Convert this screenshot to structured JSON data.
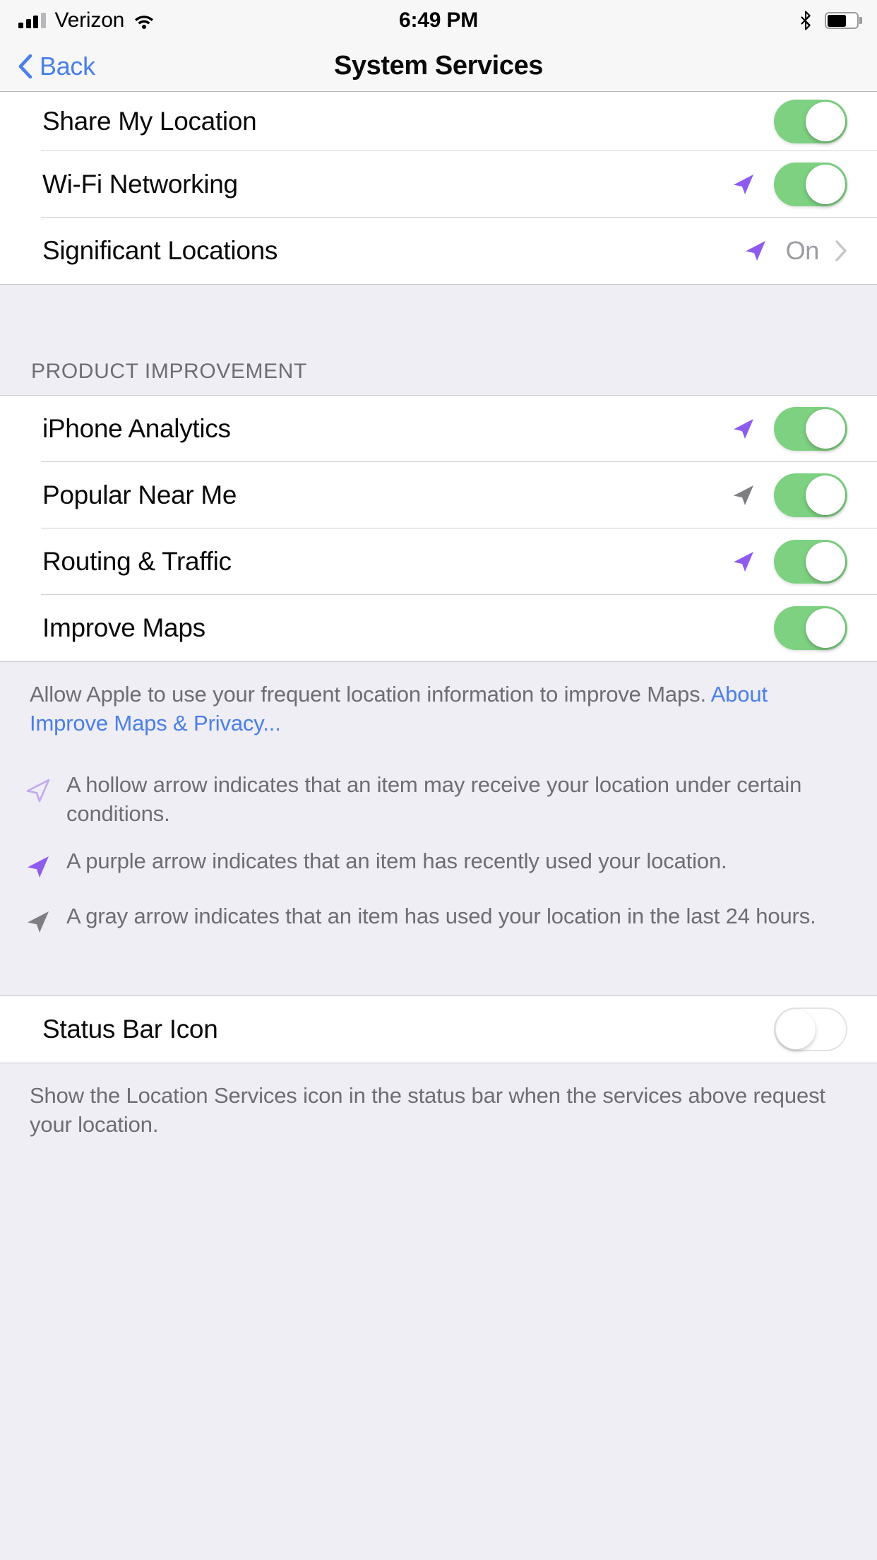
{
  "status_bar": {
    "carrier": "Verizon",
    "time": "6:49 PM",
    "signal_bars_filled": 3,
    "signal_bars_total": 4,
    "wifi_icon": "wifi-icon",
    "bluetooth_icon": "bluetooth-icon",
    "battery_icon": "battery-icon",
    "battery_level_pct": 60
  },
  "nav": {
    "back_label": "Back",
    "title": "System Services"
  },
  "section_top": {
    "rows": [
      {
        "label": "Share My Location",
        "indicator": "none",
        "control": "toggle",
        "toggle_on": true
      },
      {
        "label": "Wi-Fi Networking",
        "indicator": "purple",
        "control": "toggle",
        "toggle_on": true
      },
      {
        "label": "Significant Locations",
        "indicator": "purple",
        "control": "disclosure",
        "value": "On"
      }
    ]
  },
  "section_product_improvement": {
    "header": "PRODUCT IMPROVEMENT",
    "rows": [
      {
        "label": "iPhone Analytics",
        "indicator": "purple",
        "control": "toggle",
        "toggle_on": true
      },
      {
        "label": "Popular Near Me",
        "indicator": "gray",
        "control": "toggle",
        "toggle_on": true
      },
      {
        "label": "Routing & Traffic",
        "indicator": "purple",
        "control": "toggle",
        "toggle_on": true
      },
      {
        "label": "Improve Maps",
        "indicator": "none",
        "control": "toggle",
        "toggle_on": true
      }
    ],
    "footer_text": "Allow Apple to use your frequent location information to improve Maps. ",
    "footer_link": "About Improve Maps & Privacy..."
  },
  "legend": {
    "items": [
      {
        "icon": "hollow-arrow-icon",
        "text": "A hollow arrow indicates that an item may receive your location under certain conditions."
      },
      {
        "icon": "purple-arrow-icon",
        "text": "A purple arrow indicates that an item has recently used your location."
      },
      {
        "icon": "gray-arrow-icon",
        "text": "A gray arrow indicates that an item has used your location in the last 24 hours."
      }
    ]
  },
  "section_status_bar_icon": {
    "rows": [
      {
        "label": "Status Bar Icon",
        "indicator": "none",
        "control": "toggle",
        "toggle_on": false
      }
    ],
    "footer_text": "Show the Location Services icon in the status bar when the services above request your location."
  },
  "colors": {
    "accent_blue": "#4A7FE8",
    "toggle_on_green": "#7DD181",
    "arrow_purple": "#8E5BEF",
    "arrow_gray": "#7E7E83",
    "group_bg": "#EFEEF4",
    "row_bg": "#FFFFFF",
    "separator": "#D2D1D6",
    "secondary_text": "#6D6D72"
  }
}
